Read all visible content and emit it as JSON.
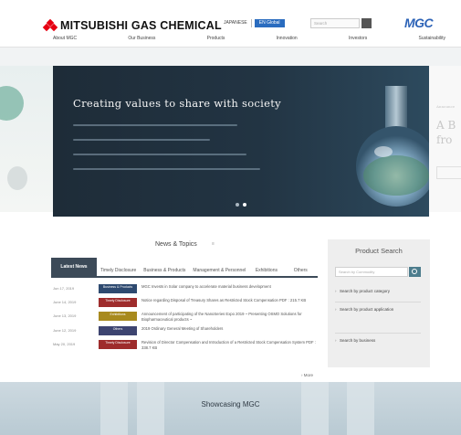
{
  "header": {
    "company_name": "MITSUBISHI GAS CHEMICAL",
    "lang_japanese": "JAPANESE",
    "lang_english": "EN Global",
    "search_placeholder": "Search",
    "brand_mark": "MGC"
  },
  "nav": {
    "items": [
      {
        "label": "About MGC"
      },
      {
        "label": "Our Business"
      },
      {
        "label": "Products"
      },
      {
        "label": "Innovation"
      },
      {
        "label": "Investors"
      },
      {
        "label": "Sustainability"
      }
    ]
  },
  "hero": {
    "title": "Creating values to share with society",
    "right_peek_1": "Announce",
    "right_peek_2": "A B",
    "right_peek_3": "fro"
  },
  "news": {
    "heading": "News & Topics",
    "tabs": [
      {
        "label": "Latest News"
      },
      {
        "label": "Timely Disclosure"
      },
      {
        "label": "Business & Products"
      },
      {
        "label": "Management & Personnel"
      },
      {
        "label": "Exhibitions"
      },
      {
        "label": "Others"
      }
    ],
    "items": [
      {
        "date": "Jun 17, 2019",
        "category": "Business & Products",
        "cat_color": "#2e4a70",
        "text": "MGC Invests in Solar company to accelerate material business development"
      },
      {
        "date": "June 14, 2019",
        "category": "Timely Disclosure",
        "cat_color": "#9e2c2c",
        "text": "Notice regarding Disposal of Treasury Shares as Restricted Stock Compensation  PDF : 215.7 KB"
      },
      {
        "date": "June 13, 2019",
        "category": "Exhibitions",
        "cat_color": "#a88a1e",
        "text": "Announcement of participating of the NanoSeries Expo 2019 ~ Presenting OSMO Solutions for Biopharmaceutical products ~"
      },
      {
        "date": "June 12, 2019",
        "category": "Others",
        "cat_color": "#3d4470",
        "text": "2019 Ordinary General Meeting of Shareholders"
      },
      {
        "date": "May 20, 2019",
        "category": "Timely Disclosure",
        "cat_color": "#9e2c2c",
        "text": "Revision of Director Compensation and Introduction of a Restricted Stock Compensation System  PDF : 338.7 KB"
      }
    ],
    "more_label": "› More"
  },
  "product_search": {
    "title": "Product Search",
    "placeholder": "Search by Commodity",
    "links": [
      {
        "label": "Search by product category"
      },
      {
        "label": "Search by product application"
      },
      {
        "label": "Search by business"
      }
    ]
  },
  "showcase": {
    "title": "Showcasing MGC"
  }
}
